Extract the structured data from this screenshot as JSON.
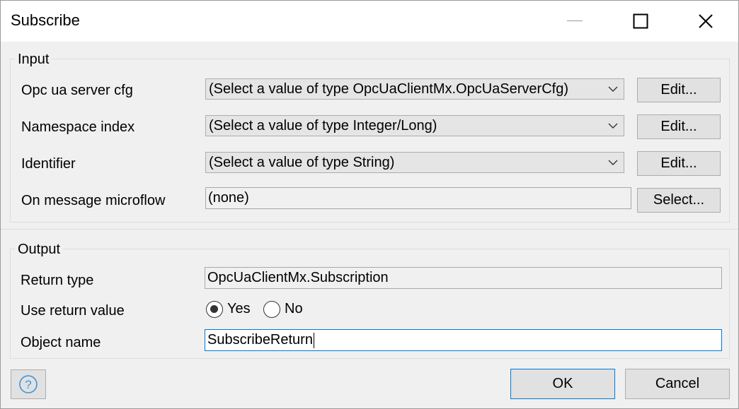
{
  "window": {
    "title": "Subscribe"
  },
  "input": {
    "legend": "Input",
    "rows": [
      {
        "label": "Opc ua server cfg",
        "value": "(Select a value of type OpcUaClientMx.OpcUaServerCfg)",
        "button": "Edit..."
      },
      {
        "label": "Namespace index",
        "value": "(Select a value of type Integer/Long)",
        "button": "Edit..."
      },
      {
        "label": "Identifier",
        "value": "(Select a value of type String)",
        "button": "Edit..."
      }
    ],
    "microflow": {
      "label": "On message microflow",
      "value": "(none)",
      "button": "Select..."
    }
  },
  "output": {
    "legend": "Output",
    "return_type": {
      "label": "Return type",
      "value": "OpcUaClientMx.Subscription"
    },
    "use_return_value": {
      "label": "Use return value",
      "yes": "Yes",
      "no": "No",
      "selected": "Yes"
    },
    "object_name": {
      "label": "Object name",
      "value": "SubscribeReturn"
    }
  },
  "footer": {
    "ok": "OK",
    "cancel": "Cancel"
  },
  "icons": {
    "minimize": "minimize-icon",
    "maximize": "maximize-icon",
    "close": "close-icon",
    "help": "help-icon",
    "chevron": "chevron-down-icon"
  }
}
